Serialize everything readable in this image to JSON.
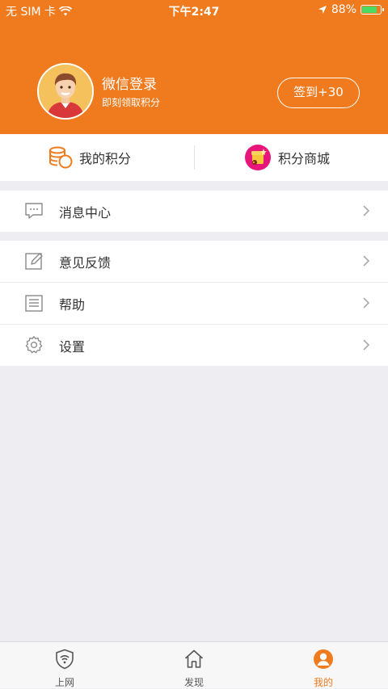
{
  "status_bar": {
    "carrier": "无 SIM 卡",
    "time": "下午2:47",
    "battery": "88%",
    "battery_level": 0.88
  },
  "profile": {
    "name": "微信登录",
    "subtitle": "即刻领取积分",
    "checkin_label": "签到+30"
  },
  "points": {
    "my_points": "我的积分",
    "points_mall": "积分商城"
  },
  "menu": {
    "group1": [
      {
        "label": "消息中心",
        "icon": "message-icon"
      }
    ],
    "group2": [
      {
        "label": "意见反馈",
        "icon": "edit-icon"
      },
      {
        "label": "帮助",
        "icon": "list-icon"
      },
      {
        "label": "设置",
        "icon": "gear-icon"
      }
    ]
  },
  "tabbar": {
    "items": [
      {
        "label": "上网",
        "icon": "wifi-shield-icon",
        "active": false
      },
      {
        "label": "发现",
        "icon": "home-icon",
        "active": false
      },
      {
        "label": "我的",
        "icon": "user-icon",
        "active": true
      }
    ]
  },
  "colors": {
    "brand": "#f07b1f",
    "background": "#eeeef2",
    "battery_fill": "#4cd964"
  }
}
